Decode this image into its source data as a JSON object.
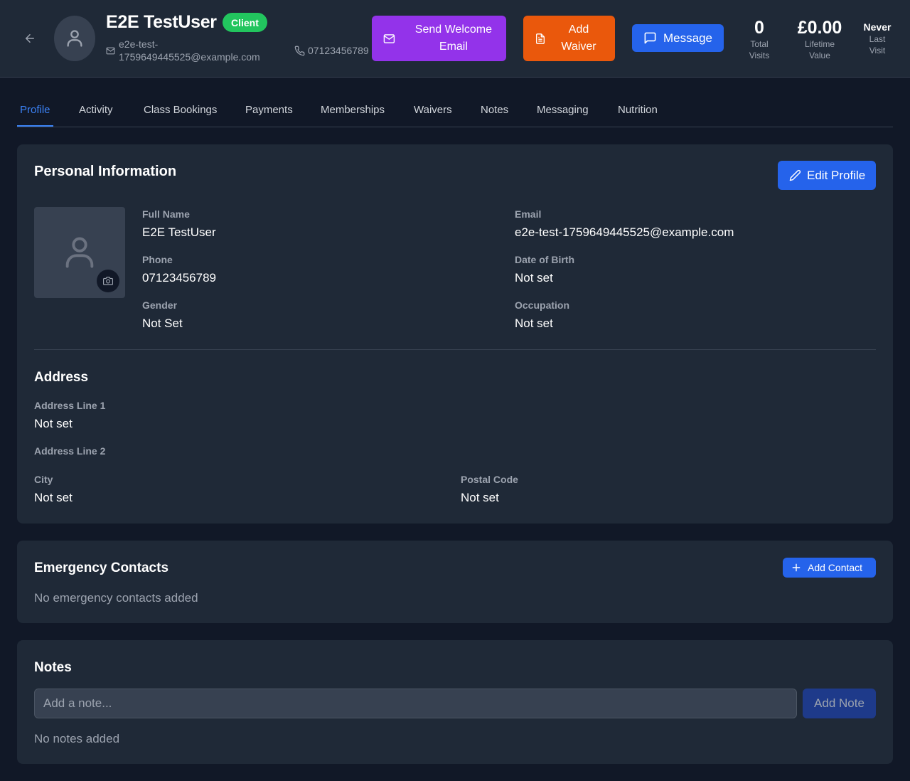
{
  "header": {
    "name": "E2E TestUser",
    "badge": "Client",
    "email_line1": "e2e-test-",
    "email_line2": "1759649445525@example.com",
    "phone": "07123456789",
    "actions": {
      "welcome_line1": "Send Welcome",
      "welcome_line2": "Email",
      "waiver_line1": "Add",
      "waiver_line2": "Waiver",
      "message": "Message"
    },
    "stats": {
      "visits_value": "0",
      "visits_label1": "Total",
      "visits_label2": "Visits",
      "lifetime_value": "£0.00",
      "lifetime_label1": "Lifetime",
      "lifetime_label2": "Value",
      "last_value": "Never",
      "last_label1": "Last",
      "last_label2": "Visit"
    }
  },
  "tabs": [
    "Profile",
    "Activity",
    "Class Bookings",
    "Payments",
    "Memberships",
    "Waivers",
    "Notes",
    "Messaging",
    "Nutrition"
  ],
  "active_tab": "Profile",
  "personal": {
    "title": "Personal Information",
    "edit_label": "Edit Profile",
    "fields": {
      "full_name_label": "Full Name",
      "full_name": "E2E TestUser",
      "email_label": "Email",
      "email": "e2e-test-1759649445525@example.com",
      "phone_label": "Phone",
      "phone": "07123456789",
      "dob_label": "Date of Birth",
      "dob": "Not set",
      "gender_label": "Gender",
      "gender": "Not Set",
      "occupation_label": "Occupation",
      "occupation": "Not set"
    },
    "address": {
      "title": "Address",
      "line1_label": "Address Line 1",
      "line1": "Not set",
      "line2_label": "Address Line 2",
      "city_label": "City",
      "city": "Not set",
      "postal_label": "Postal Code",
      "postal": "Not set"
    }
  },
  "emergency": {
    "title": "Emergency Contacts",
    "add_label": "Add Contact",
    "empty": "No emergency contacts added"
  },
  "notes": {
    "title": "Notes",
    "placeholder": "Add a note...",
    "add_label": "Add Note",
    "empty": "No notes added"
  },
  "colors": {
    "background": "#111827",
    "surface": "#1f2937",
    "accent": "#2563eb",
    "purple": "#9333ea",
    "orange": "#ea580c",
    "badge_green": "#22c55e"
  },
  "icons": [
    "back-arrow-icon",
    "user-icon",
    "mail-icon",
    "phone-icon",
    "document-icon",
    "chat-icon",
    "pencil-icon",
    "camera-icon",
    "plus-icon"
  ]
}
